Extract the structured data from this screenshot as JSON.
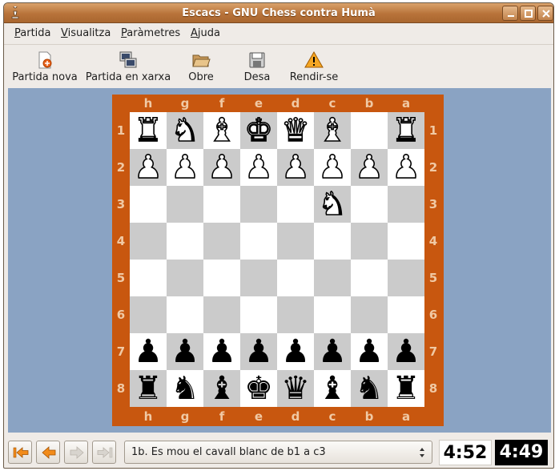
{
  "window": {
    "title": "Escacs - GNU Chess contra Humà",
    "controls": [
      "minimize-icon",
      "maximize-icon",
      "close-icon"
    ]
  },
  "menu": [
    {
      "label": "Partida",
      "mnemonic": "P"
    },
    {
      "label": "Visualitza",
      "mnemonic": "V"
    },
    {
      "label": "Paràmetres",
      "mnemonic": "P"
    },
    {
      "label": "Ajuda",
      "mnemonic": "A"
    }
  ],
  "toolbar": [
    {
      "label": "Partida nova",
      "icon": "new-game-icon"
    },
    {
      "label": "Partida en xarxa",
      "icon": "network-game-icon"
    },
    {
      "label": "Obre",
      "icon": "open-folder-icon"
    },
    {
      "label": "Desa",
      "icon": "save-floppy-icon"
    },
    {
      "label": "Rendir-se",
      "icon": "warning-icon"
    }
  ],
  "board": {
    "files": [
      "h",
      "g",
      "f",
      "e",
      "d",
      "c",
      "b",
      "a"
    ],
    "ranks": [
      "1",
      "2",
      "3",
      "4",
      "5",
      "6",
      "7",
      "8"
    ],
    "colors": {
      "frame": "#c8570f",
      "light": "#ffffff",
      "dark": "#cbcbcb",
      "background": "#8aa3c3"
    },
    "rows": [
      [
        "wR",
        "wN",
        "wB",
        "wK",
        "wQ",
        "wB",
        "",
        "wR"
      ],
      [
        "wP",
        "wP",
        "wP",
        "wP",
        "wP",
        "wP",
        "wP",
        "wP"
      ],
      [
        "",
        "",
        "",
        "",
        "",
        "wN",
        "",
        ""
      ],
      [
        "",
        "",
        "",
        "",
        "",
        "",
        "",
        ""
      ],
      [
        "",
        "",
        "",
        "",
        "",
        "",
        "",
        ""
      ],
      [
        "",
        "",
        "",
        "",
        "",
        "",
        "",
        ""
      ],
      [
        "bP",
        "bP",
        "bP",
        "bP",
        "bP",
        "bP",
        "bP",
        "bP"
      ],
      [
        "bR",
        "bN",
        "bB",
        "bK",
        "bQ",
        "bB",
        "bN",
        "bR"
      ]
    ]
  },
  "navigation": [
    {
      "name": "first-move",
      "enabled": true
    },
    {
      "name": "previous-move",
      "enabled": true
    },
    {
      "name": "next-move",
      "enabled": false
    },
    {
      "name": "last-move",
      "enabled": false
    }
  ],
  "move_history": {
    "selected": "1b. Es mou el cavall blanc de b1 a c3"
  },
  "clocks": {
    "white": "4:52",
    "black": "4:49"
  }
}
